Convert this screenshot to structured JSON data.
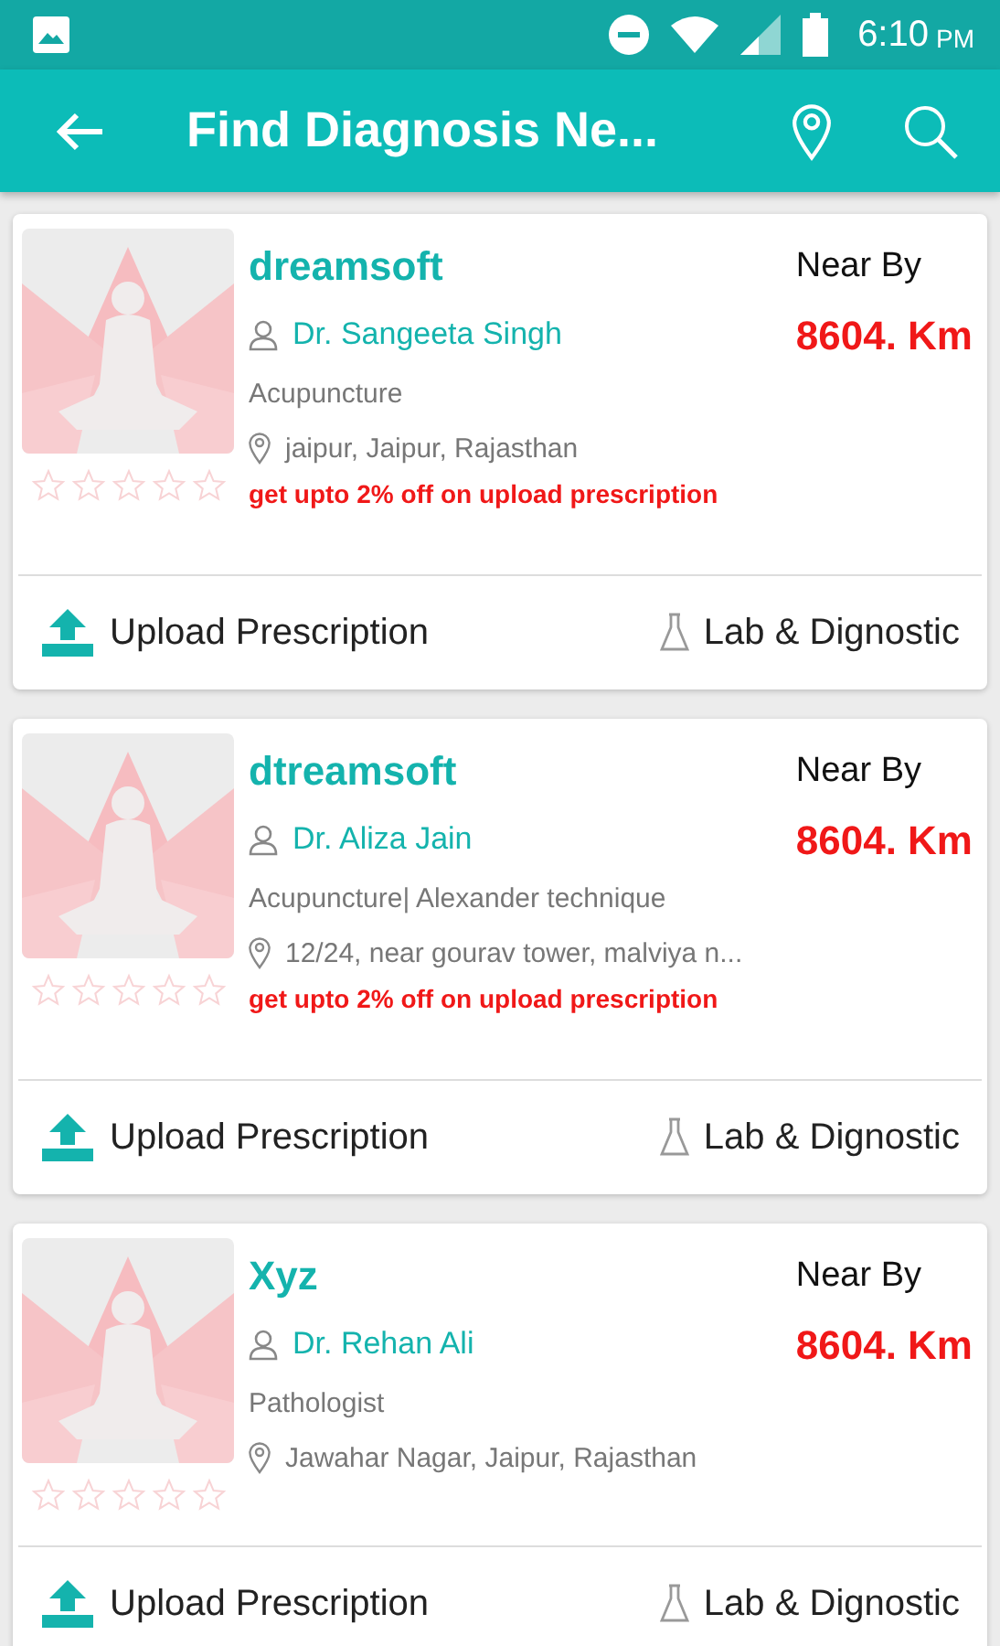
{
  "status_bar": {
    "time": "6:10",
    "ampm": "PM"
  },
  "app_bar": {
    "title": "Find Diagnosis Ne..."
  },
  "cards": [
    {
      "name": "dreamsoft",
      "doctor": "Dr. Sangeeta Singh",
      "specialty": "Acupuncture",
      "address": "jaipur, Jaipur, Rajasthan",
      "offer": "get upto 2% off on upload prescription",
      "near_label": "Near By",
      "distance": "8604. Km",
      "stars": 0,
      "image": {
        "kind": "picture"
      },
      "actions": [
        "Upload Prescription",
        "Lab & Dignostic"
      ]
    },
    {
      "name": "dtreamsoft",
      "doctor": "Dr. Aliza Jain",
      "specialty": "Acupuncture| Alexander technique",
      "address": "12/24, near gourav tower, malviya n...",
      "offer": "get upto 2% off on upload prescription",
      "near_label": "Near By",
      "distance": "8604. Km",
      "stars": 0,
      "image": {
        "kind": "picture"
      },
      "actions": [
        "Upload Prescription",
        "Lab & Dignostic"
      ]
    },
    {
      "name": "Xyz",
      "doctor": "Dr. Rehan Ali",
      "specialty": "Pathologist",
      "address": "Jawahar Nagar, Jaipur, Rajasthan",
      "near_label": "Near By",
      "distance": "8604. Km",
      "stars": 0,
      "image": {
        "kind": "picture"
      },
      "actions": [
        "Upload Prescription",
        "Lab & Dignostic"
      ]
    }
  ]
}
